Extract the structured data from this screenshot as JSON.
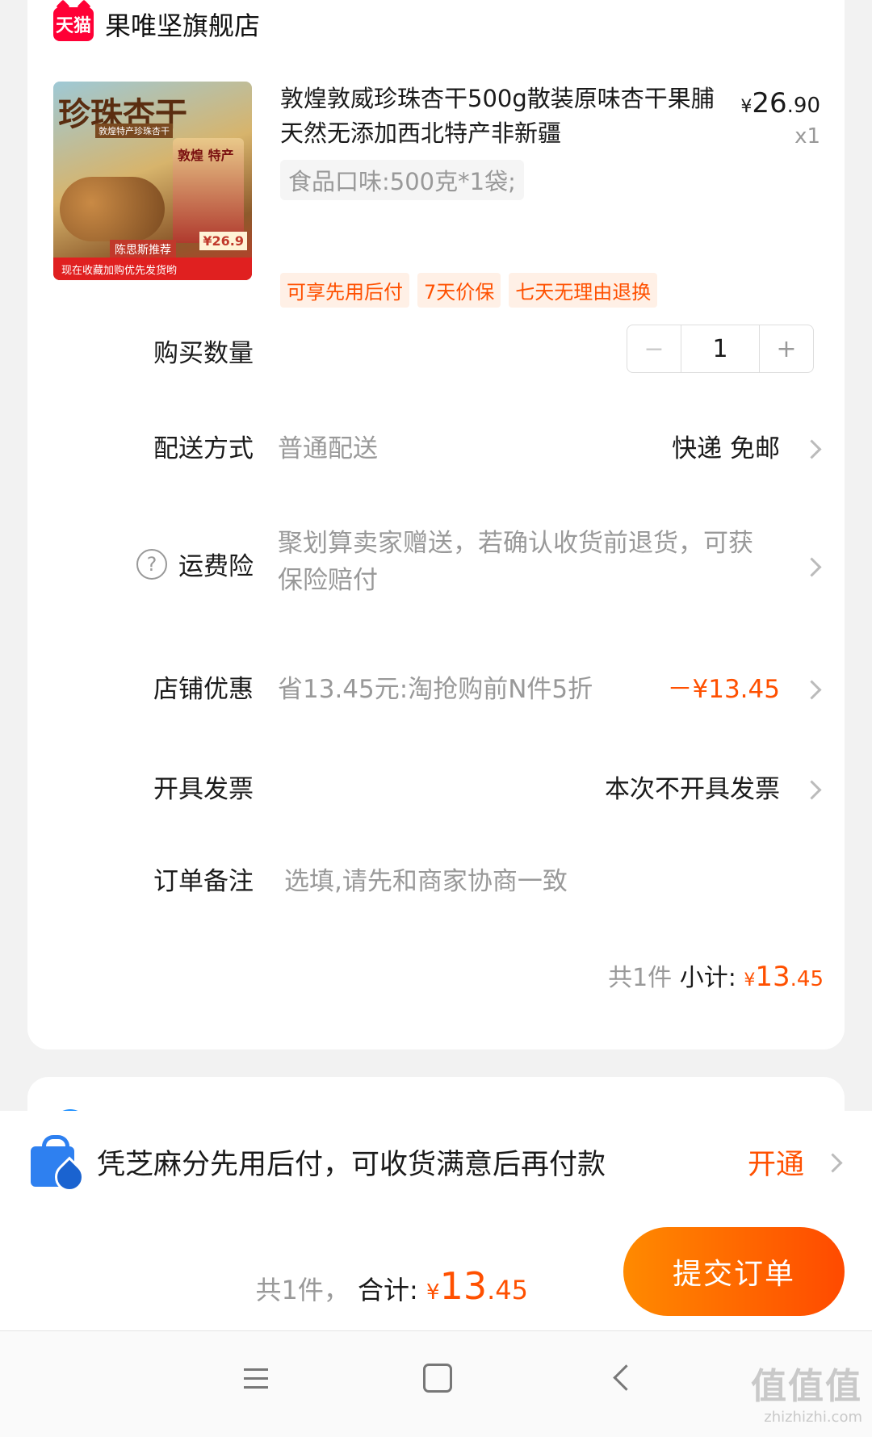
{
  "store": {
    "badge": "天猫",
    "name": "果唯坚旗舰店"
  },
  "product": {
    "title": "敦煌敦威珍珠杏干500g散装原味杏干果脯天然无添加西北特产非新疆",
    "price_symbol": "¥",
    "price_int": "26",
    "price_dec": ".90",
    "quantity_label": "x1",
    "variant": "食品口味:500克*1袋;",
    "tags": [
      "可享先用后付",
      "7天价保",
      "七天无理由退换"
    ],
    "image_text": {
      "title": "珍珠杏干",
      "subtitle": "敦煌特产珍珠杏干",
      "bag_text": "敦煌 特产",
      "recommend": "陈思斯推荐",
      "promo_price": "¥26.9",
      "bottom": "现在收藏加购优先发货哟"
    }
  },
  "rows": {
    "quantity": {
      "label": "购买数量",
      "value": "1",
      "minus": "−",
      "plus": "+"
    },
    "delivery": {
      "label": "配送方式",
      "value": "普通配送",
      "right": "快递 免邮"
    },
    "insurance": {
      "label": "运费险",
      "icon": "?",
      "value": "聚划算卖家赠送，若确认收货前退货，可获保险赔付"
    },
    "discount": {
      "label": "店铺优惠",
      "value": "省13.45元:淘抢购前N件5折",
      "right": "－¥13.45"
    },
    "invoice": {
      "label": "开具发票",
      "right": "本次不开具发票"
    },
    "note": {
      "label": "订单备注",
      "placeholder": "选填,请先和商家协商一致"
    }
  },
  "subtotal": {
    "count": "共1件",
    "label": "小计:",
    "symbol": "¥",
    "int": "13",
    "dec": ".45"
  },
  "promo": {
    "text": "凭芝麻分先用后付，可收货满意后再付款",
    "action": "开通"
  },
  "footer": {
    "count": "共1件，",
    "label": "合计:",
    "symbol": "¥",
    "int": "13",
    "dec": ".45",
    "submit": "提交订单"
  },
  "watermark": {
    "big": "值值值",
    "small": "zhizhizhi.com"
  },
  "colors": {
    "accent": "#ff5000",
    "tmall": "#ff0036",
    "alipay_blue": "#2e80f0"
  }
}
